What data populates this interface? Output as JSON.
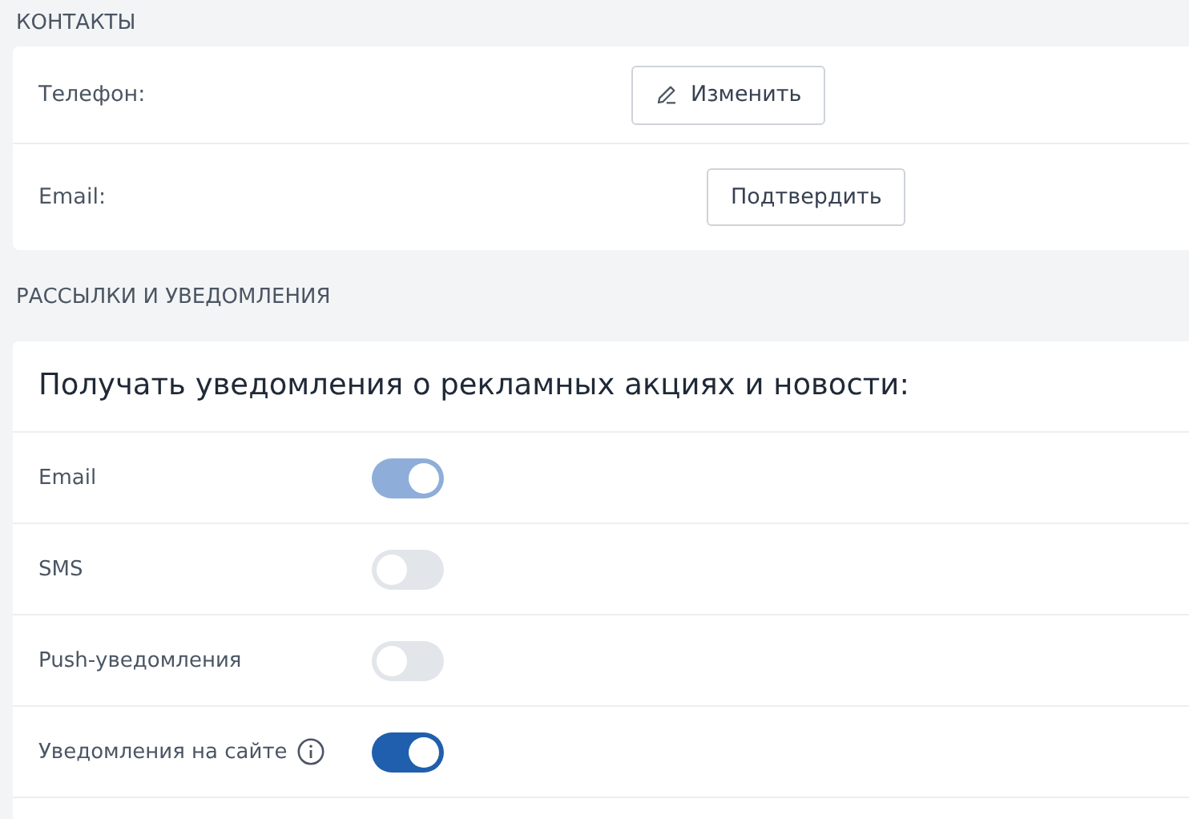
{
  "contacts": {
    "heading": "КОНТАКТЫ",
    "rows": [
      {
        "label": "Телефон:",
        "button": {
          "label": "Изменить",
          "kind": "edit"
        }
      },
      {
        "label": "Email:",
        "button": {
          "label": "Подтвердить",
          "kind": "plain"
        }
      }
    ]
  },
  "notifications": {
    "heading": "РАССЫЛКИ И УВЕДОМЛЕНИЯ",
    "title": "Получать уведомления о рекламных акциях и новости:",
    "channels": [
      {
        "label": "Email",
        "on": true,
        "disabled": true,
        "kind": "plain"
      },
      {
        "label": "SMS",
        "on": false,
        "disabled": false,
        "kind": "plain"
      },
      {
        "label": "Push-уведомления",
        "on": false,
        "disabled": false,
        "kind": "plain"
      },
      {
        "label": "Уведомления на сайте",
        "on": true,
        "disabled": false,
        "kind": "with-info"
      }
    ]
  }
}
